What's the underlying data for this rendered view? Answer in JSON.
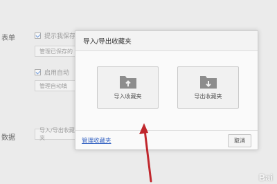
{
  "background": {
    "section_form": "表单",
    "option_prompt_save": "提示我保存",
    "btn_manage_saved": "管理已保存的",
    "option_autofill": "启用自动",
    "btn_manage_autofill": "管理自动填",
    "section_data": "数据",
    "btn_import_export": "导入/导出收藏夹"
  },
  "dialog": {
    "title": "导入/导出收藏夹",
    "import_label": "导入收藏夹",
    "export_label": "导出收藏夹",
    "manage_link": "管理收藏夹",
    "cancel_label": "取消"
  },
  "annotation": {
    "arrow_color": "#c0272d"
  },
  "watermark": {
    "text": "Bai"
  }
}
